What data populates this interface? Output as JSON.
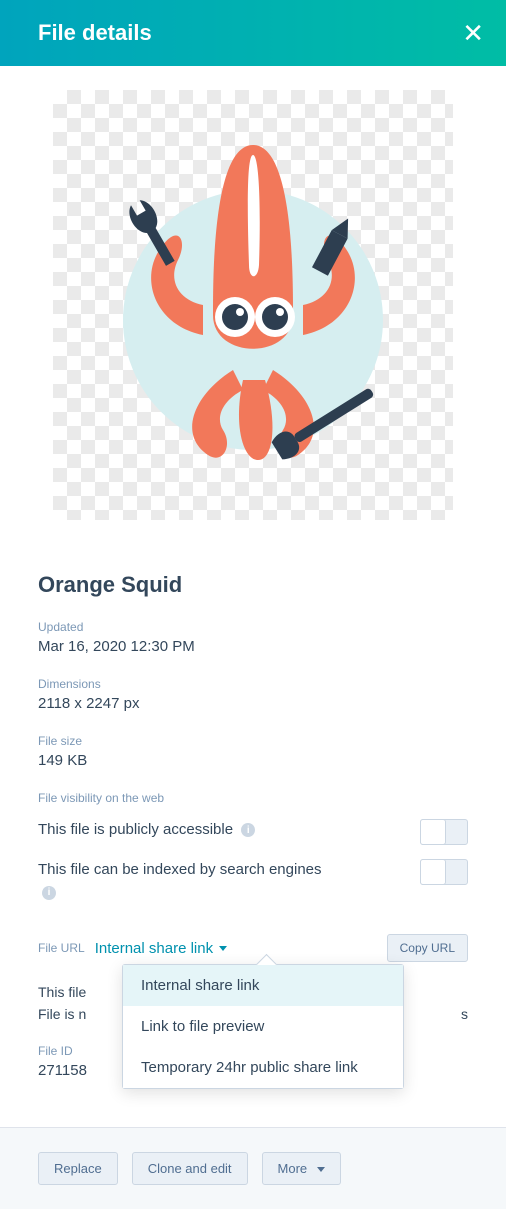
{
  "header": {
    "title": "File details"
  },
  "file": {
    "name": "Orange Squid",
    "updated_label": "Updated",
    "updated_value": "Mar 16, 2020 12:30 PM",
    "dimensions_label": "Dimensions",
    "dimensions_value": "2118 x 2247 px",
    "size_label": "File size",
    "size_value": "149 KB",
    "id_label": "File ID",
    "id_value": "271158"
  },
  "visibility": {
    "section_label": "File visibility on the web",
    "public_text": "This file is publicly accessible",
    "index_text": "This file can be indexed by search engines",
    "info_glyph": "i"
  },
  "url": {
    "label": "File URL",
    "selected": "Internal share link",
    "copy_btn": "Copy URL",
    "options": [
      "Internal share link",
      "Link to file preview",
      "Temporary 24hr public share link"
    ],
    "hint_line1": "This file",
    "hint_line2_prefix": "File is n",
    "hint_line2_suffix": "s"
  },
  "footer": {
    "replace": "Replace",
    "clone": "Clone and edit",
    "more": "More"
  }
}
